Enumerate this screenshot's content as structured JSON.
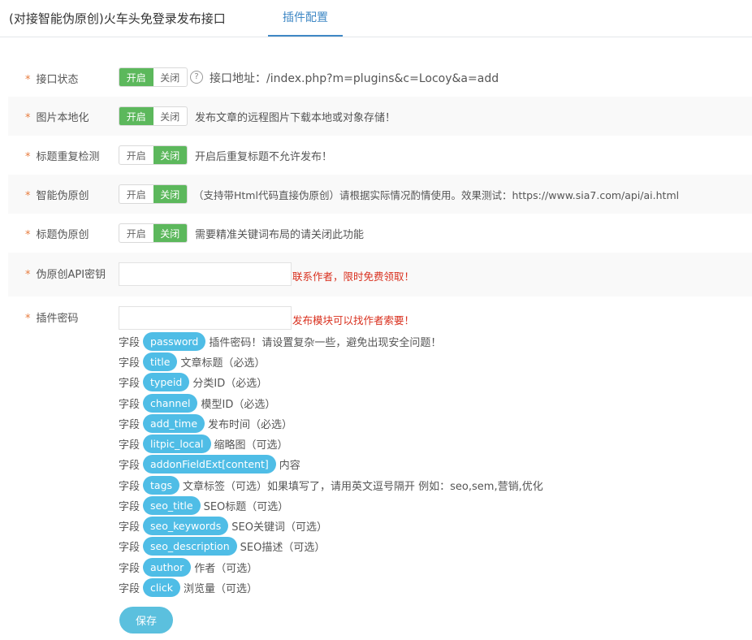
{
  "tabs": {
    "title": "(对接智能伪原创)火车头免登录发布接口",
    "active": "插件配置"
  },
  "rows": [
    {
      "label": "接口状态",
      "switch": {
        "on": "开启",
        "off": "关闭",
        "selected": "on"
      },
      "help": "?",
      "desc": "接口地址：/index.php?m=plugins&c=Locoy&a=add"
    },
    {
      "label": "图片本地化",
      "switch": {
        "on": "开启",
        "off": "关闭",
        "selected": "on"
      },
      "desc": "发布文章的远程图片下载本地或对象存储！"
    },
    {
      "label": "标题重复检测",
      "switch": {
        "on": "开启",
        "off": "关闭",
        "selected": "off"
      },
      "desc": "开启后重复标题不允许发布！"
    },
    {
      "label": "智能伪原创",
      "switch": {
        "on": "开启",
        "off": "关闭",
        "selected": "off"
      },
      "desc": "（支持带Html代码直接伪原创）请根据实际情况酌情使用。效果测试：https://www.sia7.com/api/ai.html"
    },
    {
      "label": "标题伪原创",
      "switch": {
        "on": "开启",
        "off": "关闭",
        "selected": "off"
      },
      "desc": "需要精准关键词布局的请关闭此功能"
    },
    {
      "label": "伪原创API密钥",
      "value": "",
      "note": "联系作者，限时免费领取！"
    },
    {
      "label": "插件密码",
      "value": "",
      "note": "发布模块可以找作者索要！"
    }
  ],
  "field_prefix": "字段",
  "fields": [
    {
      "name": "password",
      "desc": "插件密码！请设置复杂一些，避免出现安全问题！"
    },
    {
      "name": "title",
      "desc": "文章标题（必选）"
    },
    {
      "name": "typeid",
      "desc": "分类ID（必选）"
    },
    {
      "name": "channel",
      "desc": "模型ID（必选）"
    },
    {
      "name": "add_time",
      "desc": "发布时间（必选）"
    },
    {
      "name": "litpic_local",
      "desc": "缩略图（可选）"
    },
    {
      "name": "addonFieldExt[content]",
      "desc": "内容"
    },
    {
      "name": "tags",
      "desc": "文章标签（可选）如果填写了，请用英文逗号隔开 例如：seo,sem,营销,优化"
    },
    {
      "name": "seo_title",
      "desc": "SEO标题（可选）"
    },
    {
      "name": "seo_keywords",
      "desc": "SEO关键词（可选）"
    },
    {
      "name": "seo_description",
      "desc": "SEO描述（可选）"
    },
    {
      "name": "author",
      "desc": "作者（可选）"
    },
    {
      "name": "click",
      "desc": "浏览量（可选）"
    }
  ],
  "save_label": "保存",
  "colors": {
    "switch_on": "#5cb85c",
    "pill": "#4fbde6",
    "accent": "#3f88c5",
    "warning": "#d9301e",
    "star": "#e87c3e",
    "save": "#5bc0de"
  }
}
